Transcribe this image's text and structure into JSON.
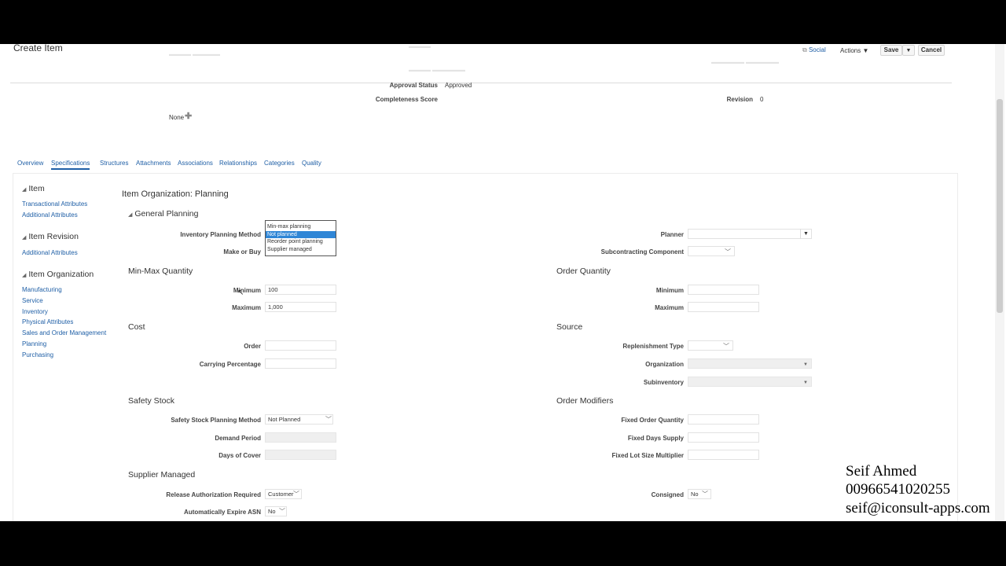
{
  "header": {
    "title": "Create Item",
    "social_label": "Social",
    "actions_label": "Actions",
    "save_label": "Save",
    "cancel_label": "Cancel"
  },
  "summary": {
    "approval_status_label": "Approval Status",
    "approval_status_value": "Approved",
    "completeness_label": "Completeness Score",
    "revision_label": "Revision",
    "revision_value": "0",
    "none_label": "None"
  },
  "tabs": [
    "Overview",
    "Specifications",
    "Structures",
    "Attachments",
    "Associations",
    "Relationships",
    "Categories",
    "Quality"
  ],
  "sidebar": {
    "item_heading": "Item",
    "item_links": [
      "Transactional Attributes",
      "Additional Attributes"
    ],
    "revision_heading": "Item Revision",
    "revision_links": [
      "Additional Attributes"
    ],
    "org_heading": "Item Organization",
    "org_links": [
      "Manufacturing",
      "Service",
      "Inventory",
      "Physical Attributes",
      "Sales and Order Management",
      "Planning",
      "Purchasing"
    ]
  },
  "main": {
    "page_title": "Item Organization: Planning",
    "general_planning": "General Planning",
    "inventory_planning_method_label": "Inventory Planning Method",
    "planning_options": [
      "Min-max planning",
      "Not planned",
      "Reorder point planning",
      "Supplier managed"
    ],
    "planning_selected": "Not planned",
    "make_or_buy_label": "Make or Buy",
    "planner_label": "Planner",
    "subcontracting_label": "Subcontracting Component",
    "minmax_section": "Min-Max Quantity",
    "minimum_label": "Minimum",
    "minimum_value": "100",
    "maximum_label": "Maximum",
    "maximum_value": "1,000",
    "order_qty_section": "Order Quantity",
    "oq_minimum_label": "Minimum",
    "oq_maximum_label": "Maximum",
    "cost_section": "Cost",
    "order_label": "Order",
    "carrying_label": "Carrying Percentage",
    "source_section": "Source",
    "replenishment_label": "Replenishment Type",
    "organization_label": "Organization",
    "subinventory_label": "Subinventory",
    "safety_section": "Safety Stock",
    "ss_method_label": "Safety Stock Planning Method",
    "ss_method_value": "Not Planned",
    "demand_period_label": "Demand Period",
    "days_cover_label": "Days of Cover",
    "order_mod_section": "Order Modifiers",
    "fixed_order_qty_label": "Fixed Order Quantity",
    "fixed_days_label": "Fixed Days Supply",
    "fixed_lot_label": "Fixed Lot Size Multiplier",
    "supplier_section": "Supplier Managed",
    "release_auth_label": "Release Authorization Required",
    "release_auth_value": "Customer",
    "auto_expire_label": "Automatically Expire ASN",
    "auto_expire_value": "No",
    "consigned_label": "Consigned",
    "consigned_value": "No"
  },
  "watermark": {
    "name": "Seif Ahmed",
    "phone": "00966541020255",
    "email": "seif@iconsult-apps.com"
  },
  "colors": {
    "link": "#1f5fa6",
    "selection": "#2f86d6"
  }
}
